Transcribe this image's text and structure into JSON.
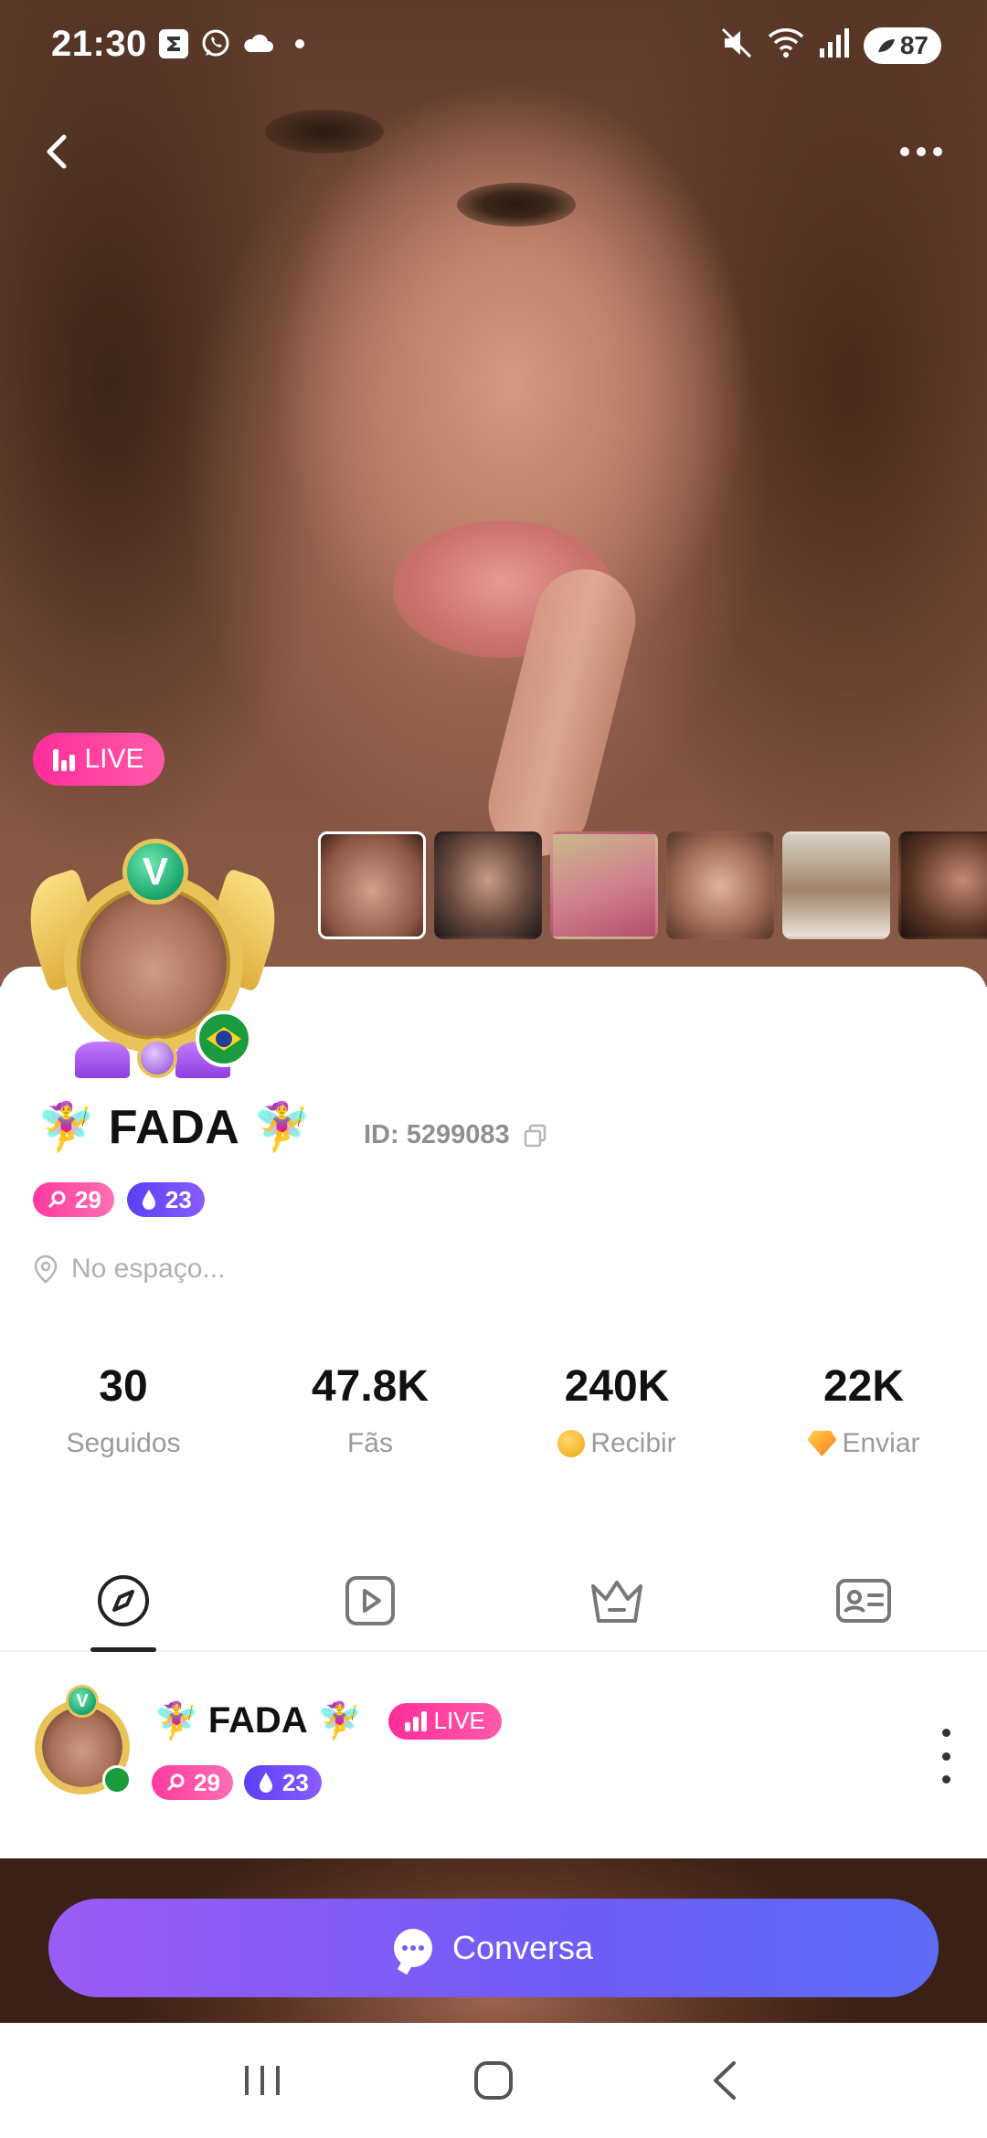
{
  "status_bar": {
    "time": "21:30",
    "battery": "87",
    "left_icons": [
      "sigma-app-icon",
      "whatsapp-icon",
      "cloud-icon",
      "dot-icon"
    ],
    "right_icons": [
      "mute-icon",
      "wifi-icon",
      "signal-icon",
      "battery-icon"
    ]
  },
  "nav": {
    "back_icon": "chevron-left-icon",
    "more_icon": "more-dots-icon"
  },
  "live_badge": {
    "label": "LIVE"
  },
  "thumbnails": [
    {
      "selected": true
    },
    {
      "selected": false
    },
    {
      "selected": false
    },
    {
      "selected": false
    },
    {
      "selected": false
    },
    {
      "selected": false
    }
  ],
  "profile": {
    "fairy_emoji": "🧚‍♀️",
    "name": "FADA",
    "id_text": "ID: 5299083",
    "level_pink": "29",
    "level_purple": "23",
    "location": "No espaço..."
  },
  "stats": [
    {
      "value": "30",
      "label": "Seguidos"
    },
    {
      "value": "47.8K",
      "label": "Fãs"
    },
    {
      "value": "240K",
      "label": "Recibir"
    },
    {
      "value": "22K",
      "label": "Enviar"
    }
  ],
  "tabs": [
    {
      "icon": "compass-icon",
      "active": true
    },
    {
      "icon": "video-play-icon",
      "active": false
    },
    {
      "icon": "crown-icon",
      "active": false
    },
    {
      "icon": "profile-card-icon",
      "active": false
    }
  ],
  "post": {
    "name": "FADA",
    "fairy_emoji": "🧚‍♀️",
    "live_label": "LIVE",
    "level_pink": "29",
    "level_purple": "23"
  },
  "chat_button": {
    "label": "Conversa"
  },
  "system_nav": [
    "recents-icon",
    "home-icon",
    "back-icon"
  ],
  "colors": {
    "live_pink": "#ff2d9b",
    "level_purple": "#5b3ff5",
    "chat_gradient_start": "#9b5cf5",
    "chat_gradient_end": "#5e6cf8"
  }
}
